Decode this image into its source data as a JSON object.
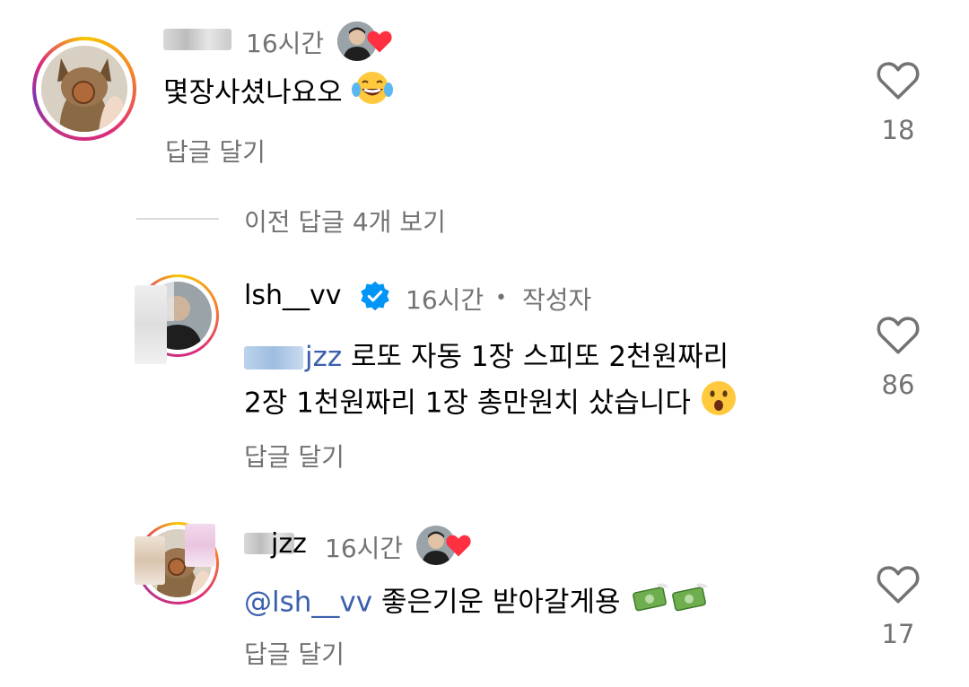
{
  "comments": [
    {
      "username": "",
      "time": "16시간",
      "text": "몇장사셨나요오",
      "reply_label": "답글 달기",
      "likes": "18"
    }
  ],
  "view_previous": "이전 답글 4개 보기",
  "replies": [
    {
      "username": "lsh__vv",
      "verified": true,
      "time": "16시간",
      "separator": "•",
      "author_tag": "작성자",
      "mention": "jzz",
      "line1": "로또 자동 1장 스피또 2천원짜리",
      "line2": "2장 1천원짜리 1장 총만원치 샀습니다",
      "reply_label": "답글 달기",
      "likes": "86"
    },
    {
      "username": "jzz",
      "time": "16시간",
      "mention": "@lsh__vv",
      "text": "좋은기운 받아갈게용",
      "reply_label": "답글 달기",
      "likes": "17"
    }
  ],
  "colors": {
    "meta_gray": "#737373",
    "heart_red": "#ff3040",
    "verified_blue": "#0095f6"
  }
}
